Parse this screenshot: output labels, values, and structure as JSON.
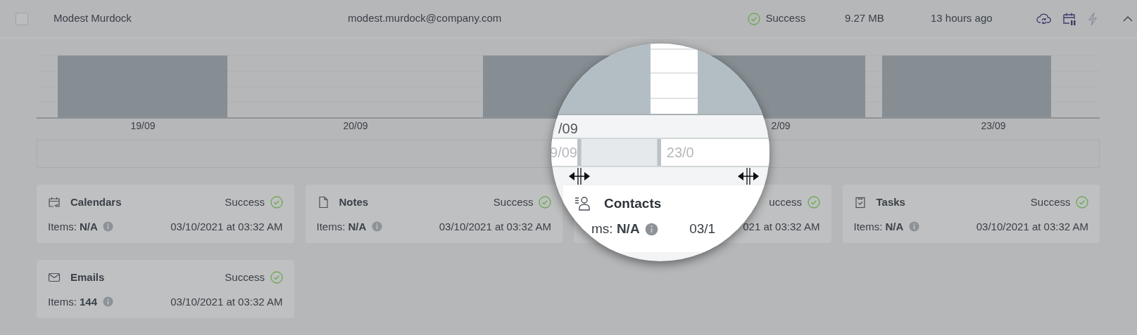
{
  "row": {
    "checked": false,
    "name": "Modest Murdock",
    "email": "modest.murdock@company.com",
    "status": "Success",
    "size": "9.27 MB",
    "time": "13 hours ago",
    "expanded": true
  },
  "timeline": {
    "labels": [
      "19/09",
      "20/09",
      "2/09",
      "23/09"
    ]
  },
  "cards": [
    {
      "kind": "calendar",
      "title": "Calendars",
      "status": "Success",
      "items_label": "Items:",
      "items": "N/A",
      "date": "03/10/2021 at 03:32 AM"
    },
    {
      "kind": "note",
      "title": "Notes",
      "status": "Success",
      "items_label": "Items:",
      "items": "N/A",
      "date": "03/10/2021 at 03:32 AM"
    },
    {
      "status": "uccess",
      "date": "021 at 03:32 AM"
    },
    {
      "kind": "task",
      "title": "Tasks",
      "status": "Success",
      "items_label": "Items:",
      "items": "N/A",
      "date": "03/10/2021 at 03:32 AM"
    },
    {
      "kind": "mail",
      "title": "Emails",
      "status": "Success",
      "items_label": "Items:",
      "items": "144",
      "date": "03/10/2021 at 03:32 AM"
    }
  ],
  "magnifier": {
    "axis_label": "/09",
    "range_start": "9/09",
    "range_end": "23/0",
    "card": {
      "kind": "contact",
      "title": "Contacts",
      "items_label": "ms:",
      "items": "N/A",
      "date": "03/1"
    }
  }
}
